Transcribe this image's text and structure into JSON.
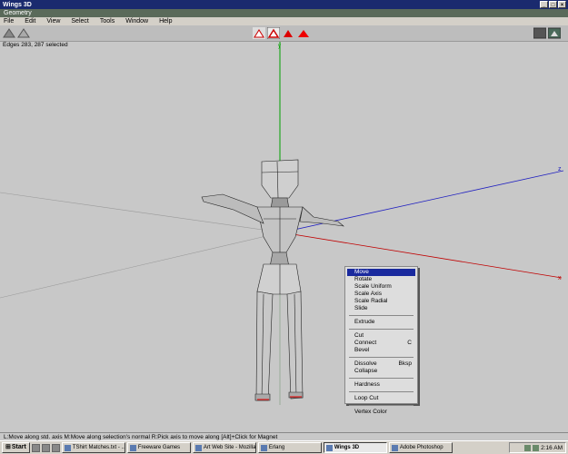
{
  "window": {
    "title": "Wings 3D"
  },
  "geometry_bar": {
    "label": "Geometry"
  },
  "menu": [
    "File",
    "Edit",
    "View",
    "Select",
    "Tools",
    "Window",
    "Help"
  ],
  "viewport": {
    "status": "Edges 283, 287 selected"
  },
  "context_menu": {
    "items": [
      {
        "label": "Move",
        "selected": true
      },
      {
        "label": "Rotate"
      },
      {
        "label": "Scale Uniform"
      },
      {
        "label": "Scale Axis"
      },
      {
        "label": "Scale Radial"
      },
      {
        "label": "Slide"
      },
      {
        "sep": true
      },
      {
        "label": "Extrude"
      },
      {
        "sep": true
      },
      {
        "label": "Cut"
      },
      {
        "label": "Connect",
        "shortcut": "C"
      },
      {
        "label": "Bevel"
      },
      {
        "sep": true
      },
      {
        "label": "Dissolve",
        "shortcut": "Bksp"
      },
      {
        "label": "Collapse"
      },
      {
        "sep": true
      },
      {
        "label": "Hardness"
      },
      {
        "sep": true
      },
      {
        "label": "Loop Cut"
      },
      {
        "sep": true
      },
      {
        "label": "Vertex Color"
      }
    ]
  },
  "help_bar": {
    "text": "L:Move along std. axis   M:Move along selection's normal   R:Pick axis to move along   [Alt]+Click for Magnet"
  },
  "taskbar": {
    "start": "Start",
    "tasks": [
      {
        "label": "TShirt Matches.txt - ..."
      },
      {
        "label": "Freeware Games"
      },
      {
        "label": "Art Web Site - Mozilla"
      },
      {
        "label": "Erlang"
      },
      {
        "label": "Wings 3D",
        "active": true
      },
      {
        "label": "Adobe Photoshop"
      }
    ],
    "clock": "2:16 AM"
  },
  "colors": {
    "title": "#1a2a6e",
    "menu_highlight": "#1a2a9e",
    "axis_x": "#c00000",
    "axis_y": "#00a000",
    "axis_z": "#2020c0"
  }
}
